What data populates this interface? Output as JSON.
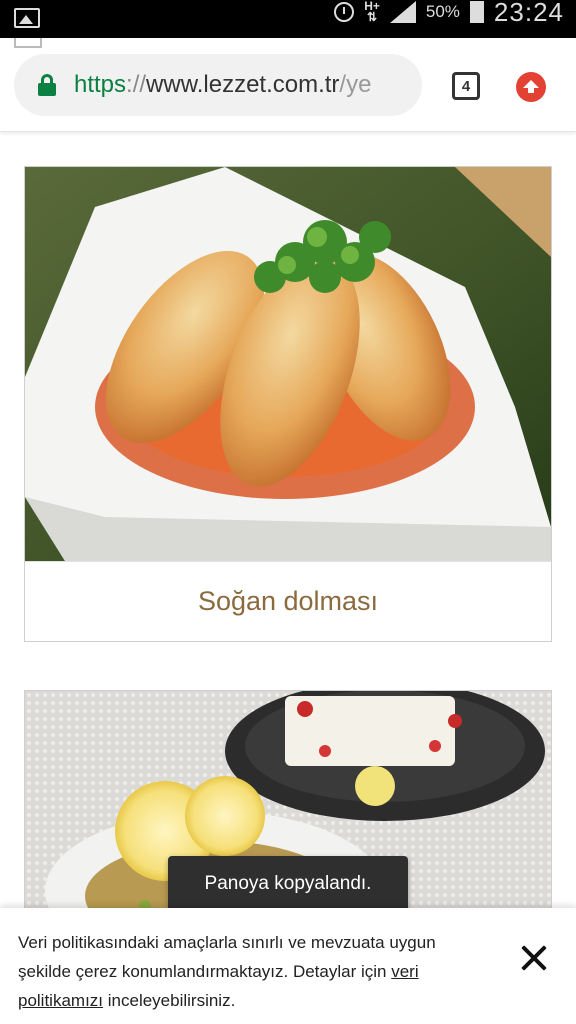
{
  "status_bar": {
    "battery": "50%",
    "time": "23:24",
    "network": "H+",
    "icons": [
      "image-icon",
      "alarm-icon",
      "network-icon",
      "signal-icon",
      "battery-icon"
    ]
  },
  "browser": {
    "url_scheme": "https",
    "url_separator": "://",
    "url_host": "www.lezzet.com.tr",
    "url_path": "/ye",
    "tab_count": "4",
    "colors": {
      "secure": "#0b8043",
      "update": "#e34133"
    }
  },
  "cards": [
    {
      "title": "Soğan dolması",
      "image": "stuffed-onion-dish-image"
    },
    {
      "title": "",
      "image": "lemon-salad-dessert-image"
    }
  ],
  "toast": {
    "text": "Panoya kopyalandı."
  },
  "cookie_banner": {
    "text_before": "Veri politikasındaki amaçlarla sınırlı ve mevzuata uygun şekilde çerez konumlandırmaktayız. Detaylar için ",
    "link_text": "veri politikamızı",
    "text_after": " inceleyebilirsiniz."
  },
  "colors": {
    "title": "#8b6b3e",
    "toast_bg": "#2f2f2f"
  }
}
